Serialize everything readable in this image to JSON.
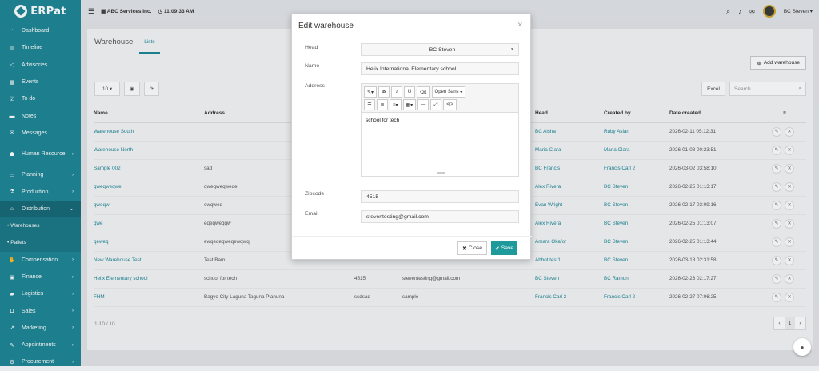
{
  "app": {
    "logo": "ERPat"
  },
  "topbar": {
    "company": "ABC Services Inc.",
    "time": "11:09:33 AM",
    "user": "BC Steven"
  },
  "sidebar": {
    "items": [
      {
        "label": "Dashboard",
        "icon": "dashboard-icon",
        "arrow": false
      },
      {
        "label": "Timeline",
        "icon": "timeline-icon",
        "arrow": false
      },
      {
        "label": "Advisories",
        "icon": "megaphone-icon",
        "arrow": false
      },
      {
        "label": "Events",
        "icon": "calendar-icon",
        "arrow": false
      },
      {
        "label": "To do",
        "icon": "checkbox-icon",
        "arrow": false
      },
      {
        "label": "Notes",
        "icon": "book-icon",
        "arrow": false
      },
      {
        "label": "Messages",
        "icon": "envelope-icon",
        "arrow": false
      },
      {
        "label": "Human Resource",
        "icon": "users-icon",
        "arrow": true
      },
      {
        "label": "Planning",
        "icon": "briefcase-icon",
        "arrow": true
      },
      {
        "label": "Production",
        "icon": "flask-icon",
        "arrow": true
      },
      {
        "label": "Distribution",
        "icon": "bank-icon",
        "arrow": true,
        "active": true
      }
    ],
    "subitems": [
      {
        "label": "Warehouses"
      },
      {
        "label": "Pallets"
      }
    ],
    "items2": [
      {
        "label": "Compensation",
        "icon": "handshake-icon"
      },
      {
        "label": "Finance",
        "icon": "money-icon"
      },
      {
        "label": "Logistics",
        "icon": "truck-icon"
      },
      {
        "label": "Sales",
        "icon": "cart-icon"
      },
      {
        "label": "Marketing",
        "icon": "chart-icon"
      },
      {
        "label": "Appointments",
        "icon": "edit-icon"
      },
      {
        "label": "Procurement",
        "icon": "procure-icon"
      }
    ]
  },
  "page": {
    "title": "Warehouse",
    "tab": "Lists",
    "add_button": "Add warehouse",
    "page_size": "10",
    "excel": "Excel",
    "search_placeholder": "Search",
    "footer_count": "1-10 / 10",
    "current_page": "1"
  },
  "table": {
    "headers": [
      "Name",
      "Address",
      "",
      "",
      "Head",
      "Created by",
      "Date created",
      "≡"
    ],
    "rows": [
      {
        "name": "Warehouse South",
        "address": "",
        "zip": "",
        "email": "",
        "head": "BC Aisha",
        "created_by": "Ruby Aslan",
        "date": "2026-02-11 05:12:31"
      },
      {
        "name": "Warehouse North",
        "address": "",
        "zip": "",
        "email": "",
        "head": "Maria Clara",
        "created_by": "Maria Clara",
        "date": "2026-01-08 00:23:51"
      },
      {
        "name": "Sample 002",
        "address": "sad",
        "zip": "",
        "email": "",
        "head": "BC Francis",
        "created_by": "Francis Carl 2",
        "date": "2026-03-02 03:58:10"
      },
      {
        "name": "qweqweqwe",
        "address": "qweqweqweqe",
        "zip": "",
        "email": "",
        "head": "Alex Rivera",
        "created_by": "BC Steven",
        "date": "2026-02-25 01:13:17"
      },
      {
        "name": "qweqw",
        "address": "ewqweq",
        "zip": "",
        "email": "",
        "head": "Evan Wright",
        "created_by": "BC Steven",
        "date": "2026-02-17 03:09:16"
      },
      {
        "name": "qwe",
        "address": "eqeqweqqw",
        "zip": "",
        "email": "",
        "head": "Alex Rivera",
        "created_by": "BC Steven",
        "date": "2026-02-25 01:13:07"
      },
      {
        "name": "qeweq",
        "address": "ewqeqeqweqewqwq",
        "zip": "",
        "email": "",
        "head": "Amara Okafor",
        "created_by": "BC Steven",
        "date": "2026-02-25 01:13:44"
      },
      {
        "name": "New Warehouse Test",
        "address": "Test Bam",
        "zip": "",
        "email": "",
        "head": "Abbot test1",
        "created_by": "BC Steven",
        "date": "2026-03-18 02:31:58"
      },
      {
        "name": "Helix Elementary school",
        "address": "school for tech",
        "zip": "4515",
        "email": "steventesting@gmail.com",
        "head": "BC Steven",
        "created_by": "BC Ramon",
        "date": "2026-02-23 02:17:27"
      },
      {
        "name": "FHM",
        "address": "Bagyo City Laguna Taguna Planuna",
        "zip": "ssdsad",
        "email": "sample",
        "head": "Francis Carl 2",
        "created_by": "Francis Carl 2",
        "date": "2026-02-27 07:06:25"
      }
    ]
  },
  "modal": {
    "title": "Edit warehouse",
    "head_label": "Head",
    "head_value": "BC Steven",
    "name_label": "Name",
    "name_value": "Helix International Elementary school",
    "address_label": "Address",
    "address_value": "school for tech",
    "font_name": "Open Sans",
    "zipcode_label": "Zipcode",
    "zipcode_value": "4515",
    "email_label": "Email",
    "email_value": "steventesting@gmail.com",
    "close_label": "Close",
    "save_label": "Save"
  },
  "colors": {
    "primary": "#1f8796",
    "save": "#1f9a9c"
  }
}
